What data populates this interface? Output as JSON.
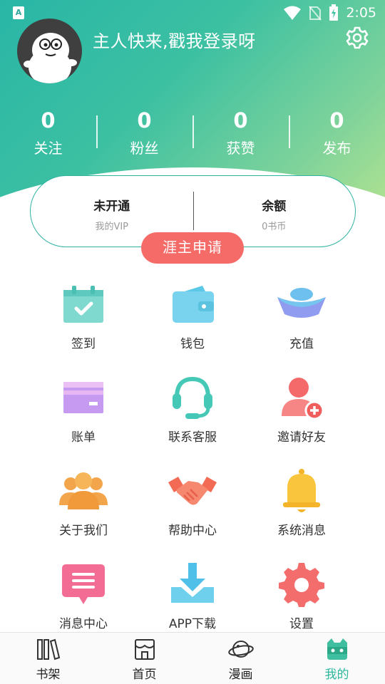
{
  "status_bar": {
    "time": "2:05",
    "notification": "A"
  },
  "header": {
    "login_prompt": "主人快来,戳我登录呀",
    "settings_icon": "gear-icon"
  },
  "stats": [
    {
      "value": "0",
      "label": "关注"
    },
    {
      "value": "0",
      "label": "粉丝"
    },
    {
      "value": "0",
      "label": "获赞"
    },
    {
      "value": "0",
      "label": "发布"
    }
  ],
  "vip_card": {
    "vip_title": "未开通",
    "vip_sub": "我的VIP",
    "balance_title": "余额",
    "balance_sub": "0书币"
  },
  "apply_button": "涯主申请",
  "grid": [
    {
      "label": "签到",
      "icon": "calendar-check-icon"
    },
    {
      "label": "钱包",
      "icon": "wallet-icon"
    },
    {
      "label": "充值",
      "icon": "ingot-icon"
    },
    {
      "label": "账单",
      "icon": "card-icon"
    },
    {
      "label": "联系客服",
      "icon": "headset-icon"
    },
    {
      "label": "邀请好友",
      "icon": "add-user-icon"
    },
    {
      "label": "关于我们",
      "icon": "group-icon"
    },
    {
      "label": "帮助中心",
      "icon": "handshake-icon"
    },
    {
      "label": "系统消息",
      "icon": "bell-icon"
    },
    {
      "label": "消息中心",
      "icon": "message-icon"
    },
    {
      "label": "APP下载",
      "icon": "download-icon"
    },
    {
      "label": "设置",
      "icon": "gear-icon"
    }
  ],
  "tabs": [
    {
      "label": "书架",
      "icon": "books-icon",
      "active": false
    },
    {
      "label": "首页",
      "icon": "store-icon",
      "active": false
    },
    {
      "label": "漫画",
      "icon": "planet-icon",
      "active": false
    },
    {
      "label": "我的",
      "icon": "cat-face-icon",
      "active": true
    }
  ],
  "colors": {
    "accent": "#2cb79c",
    "apply_button": "#f46b68",
    "hero_start": "#29b6a6",
    "hero_end": "#b9e48f"
  }
}
